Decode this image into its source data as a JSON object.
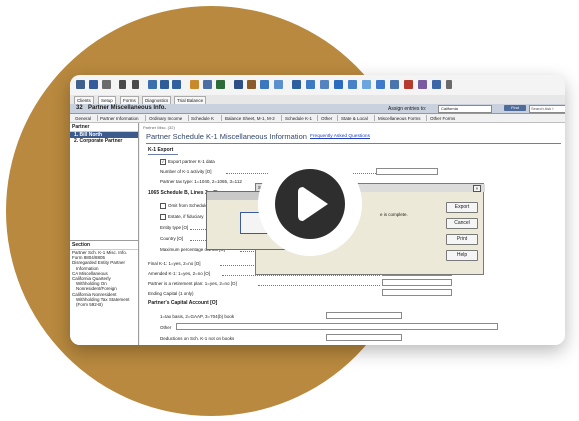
{
  "toolbar": {
    "icons": [
      "calculator-icon",
      "save-icon",
      "print-icon",
      "move-icon",
      "add-icon",
      "table-icon",
      "import-icon",
      "export-icon",
      "bookmark-icon",
      "edit-icon",
      "tools-icon",
      "box-icon",
      "grid-icon",
      "mail-icon",
      "sheet-icon",
      "info-icon",
      "docs-icon",
      "chart-icon",
      "monitor-icon",
      "folder-icon",
      "help-icon",
      "globe-icon",
      "globe2-icon",
      "alert-icon",
      "puzzle-icon",
      "pencil-icon",
      "pen-icon"
    ]
  },
  "main_tabs": [
    "Clients",
    "Setup",
    "Forms",
    "Diagnostics",
    "Trial Balance"
  ],
  "title_bar": {
    "number": "32",
    "title": "Partner Miscellaneous Info.",
    "assign_label": "Assign entries to:",
    "assign_value": "California",
    "find_label": "Find",
    "search_placeholder": "Search Ask I"
  },
  "sub_tabs": [
    "General",
    "Partner Information",
    "Ordinary Income",
    "Schedule K",
    "Balance Sheet, M-1, M-2",
    "Schedule K-1",
    "Other",
    "State & Local",
    "Miscellaneous Forms",
    "Other Forms"
  ],
  "partner_list": {
    "header": "Partner",
    "items": [
      "1. Bill North",
      "2. Corporate Partner"
    ]
  },
  "section_list": {
    "header": "Section",
    "items": [
      "Partner Sch. K-1 Misc. Info.",
      "Form 8804/8805",
      "Disregarded Entity Partner",
      "Information",
      "CA Miscellaneous",
      "California Quarterly",
      "Withholding On",
      "Nonresident/Foreign",
      "California Nonresident",
      "Withholding Tax Statement",
      "(Form 592-B)"
    ]
  },
  "form": {
    "breadcrumb": "Partner Misc. (32)",
    "title": "Partner Schedule K-1 Miscellaneous Information",
    "faq_link": "Frequently Asked Questions",
    "k1_export": "K-1 Export",
    "export_k1": "Export partner K-1 data",
    "export_k1_checked": "✓",
    "num_activity": "Number of K-1 activity [O]",
    "tax_type": "Partner tax type: 1=1040, 2=1065, 3=112",
    "sched_b": "1065 Schedule B, Lines 3a, 3b",
    "omit_b": "Omit from Schedule B",
    "estate": "Estate, if fiduciary",
    "entity": "Entity type [O]",
    "country": "Country [O]",
    "max_pct": "Maximum percentage owned [O]",
    "final_k1": "Final K-1: 1=yes, 2=no [O]",
    "amended_k1": "Amended K-1: 1=yes, 2=no [O]",
    "retirement": "Partner is a retirement plan: 1=yes, 2=no [O]",
    "ending_cap": "Ending Capital (1 only)",
    "capital": "Partner's Capital Account [O]",
    "tax_basis": "1=tax basis, 2=GAAP, 3=704(b) book",
    "other": "Other",
    "deductions": "Deductions on Sch. K-1 not on books"
  },
  "dialog": {
    "title": "Sch",
    "close": "×",
    "message": "e is complete.",
    "buttons": [
      "Export",
      "Cancel",
      "Print",
      "Help"
    ]
  },
  "play": "play-button"
}
